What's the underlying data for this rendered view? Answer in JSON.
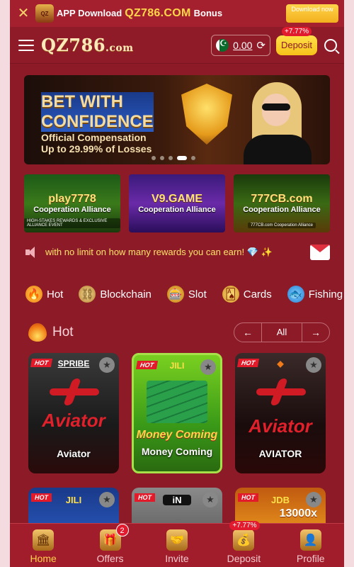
{
  "promo": {
    "close": "✕",
    "download_text": "APP Download",
    "brand": "QZ786.COM",
    "bonus": "Bonus",
    "download_button": "Download now",
    "logo_text": "QZ"
  },
  "header": {
    "logo": "QZ786",
    "logo_suffix": ".com",
    "balance": "0.00",
    "deposit_label": "Deposit",
    "deposit_badge": "+7.77%"
  },
  "banner": {
    "headline_1": "BET WITH",
    "headline_2": "CONFIDENCE",
    "sub_1": "Official Compensation",
    "sub_2": "Up to 29.99% of Losses"
  },
  "partners": [
    {
      "name": "play7778",
      "tag": "Cooperation Alliance",
      "foot": "HIGH-STAKES REWARDS & EXCLUSIVE ALLIANCE EVENT"
    },
    {
      "name": "V9.GAME",
      "tag": "Cooperation Alliance",
      "foot": ""
    },
    {
      "name": "777CB.com",
      "tag": "Cooperation Alliance",
      "foot": "777CB.com Cooperation Alliance"
    }
  ],
  "marquee": {
    "message": "with no limit on how many rewards you can earn! 💎 ✨"
  },
  "categories": [
    {
      "label": "Hot",
      "icon": "fire-icon",
      "glyph": "🔥"
    },
    {
      "label": "Blockchain",
      "icon": "blockchain-icon",
      "glyph": "⛓"
    },
    {
      "label": "Slot",
      "icon": "slot-icon",
      "glyph": "🎰"
    },
    {
      "label": "Cards",
      "icon": "cards-icon",
      "glyph": "🂡"
    },
    {
      "label": "Fishing",
      "icon": "fishing-icon",
      "glyph": "🐟"
    }
  ],
  "hot_section": {
    "title": "Hot",
    "prev": "←",
    "all": "All",
    "next": "→"
  },
  "games": [
    {
      "name": "Aviator",
      "provider": "SPRIBE",
      "art": "Aviator",
      "hot": "HOT"
    },
    {
      "name": "Money Coming",
      "provider": "JILI",
      "art": "Money Coming",
      "hot": "HOT"
    },
    {
      "name": "AVIATOR",
      "provider": "◆",
      "art": "Aviator",
      "hot": "HOT"
    }
  ],
  "games_row2": [
    {
      "provider": "JILI",
      "hot": "HOT",
      "mult": ""
    },
    {
      "provider": "iN",
      "hot": "HOT",
      "mult": ""
    },
    {
      "provider": "JDB",
      "hot": "HOT",
      "mult": "13000x"
    }
  ],
  "bottom_nav": [
    {
      "label": "Home",
      "icon": "home-icon",
      "glyph": "🏛"
    },
    {
      "label": "Offers",
      "icon": "offers-icon",
      "glyph": "🎁",
      "badge": "2"
    },
    {
      "label": "Invite",
      "icon": "invite-icon",
      "glyph": "🤝"
    },
    {
      "label": "Deposit",
      "icon": "deposit-icon",
      "glyph": "💰",
      "badge": "+7.77%"
    },
    {
      "label": "Profile",
      "icon": "profile-icon",
      "glyph": "👤"
    }
  ],
  "colors": {
    "background": "#8c1a27",
    "accent_yellow": "#ffd24a",
    "badge_red": "#e21a2e"
  }
}
